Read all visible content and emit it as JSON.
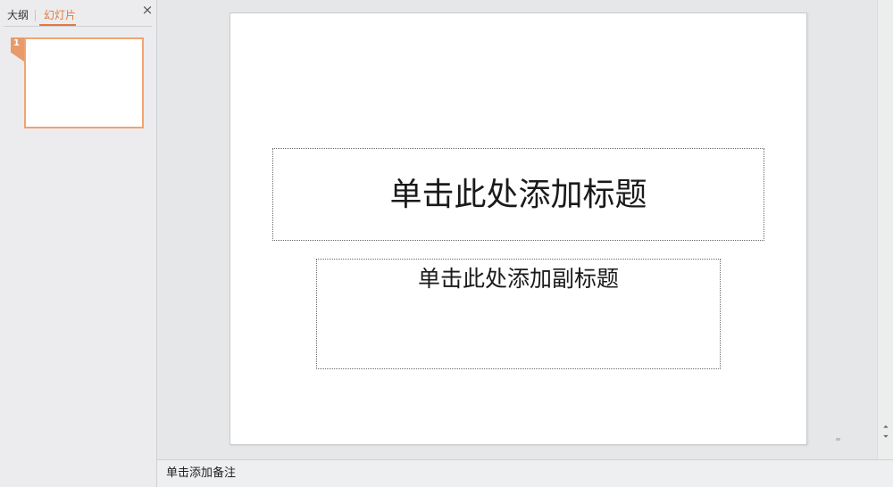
{
  "left_pane": {
    "tabs": [
      {
        "label": "大纲"
      },
      {
        "label": "幻灯片"
      }
    ],
    "close_glyph": "×",
    "slides": [
      {
        "number": "1"
      }
    ]
  },
  "slide": {
    "title_placeholder": "单击此处添加标题",
    "subtitle_placeholder": "单击此处添加副标题"
  },
  "scrollbar": {
    "prev_glyph": "⏶",
    "next_glyph": "⏷"
  },
  "notes": {
    "placeholder": "单击添加备注"
  },
  "colors": {
    "accent": "#e4783a",
    "thumb_border": "#f0a470",
    "background": "#e9eaec"
  }
}
